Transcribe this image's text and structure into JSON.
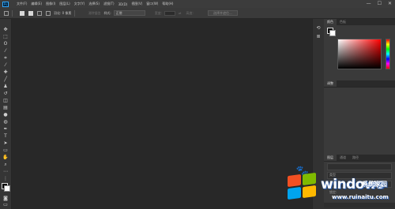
{
  "app": {
    "logo": "Ps"
  },
  "menu": [
    "文件(F)",
    "编辑(E)",
    "图像(I)",
    "图层(L)",
    "文字(Y)",
    "选择(S)",
    "滤镜(T)",
    "3D(D)",
    "视图(V)",
    "窗口(W)",
    "帮助(H)"
  ],
  "window_controls": {
    "minimize": "—",
    "maximize": "☐",
    "close": "✕"
  },
  "options": {
    "feather_label": "羽化: 0 像素",
    "style_label": "样式:",
    "style_value": "正常",
    "width_label": "宽度:",
    "height_label": "高度:",
    "select_mask_button": "选择并遮住..."
  },
  "color_panel": {
    "tabs": [
      "颜色",
      "色板"
    ]
  },
  "adjust_panel": {
    "tabs": [
      "调整"
    ]
  },
  "layers_panel": {
    "tabs": [
      "图层",
      "通道",
      "路径"
    ],
    "rows": [
      "类型",
      "正常",
      "锁定:"
    ]
  },
  "watermark": {
    "brand": "windows",
    "brand_cn": "系统家园",
    "url": "www.ruinaitu.com",
    "paw": "🐾"
  },
  "tool_icons": [
    "move-icon",
    "marquee-icon",
    "lasso-icon",
    "magic-wand-icon",
    "crop-icon",
    "eyedropper-icon",
    "healing-brush-icon",
    "brush-icon",
    "clone-stamp-icon",
    "history-brush-icon",
    "eraser-icon",
    "gradient-icon",
    "blur-icon",
    "dodge-icon",
    "pen-icon",
    "type-icon",
    "path-selection-icon",
    "rectangle-icon",
    "hand-icon",
    "zoom-icon",
    "more-tools-icon"
  ]
}
